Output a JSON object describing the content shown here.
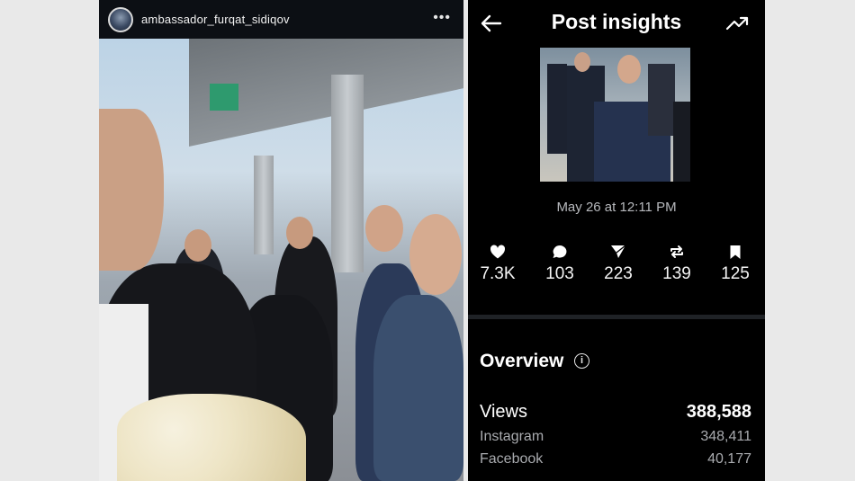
{
  "story": {
    "username": "ambassador_furqat_sidiqov",
    "more_icon": "more-horizontal-icon"
  },
  "insights": {
    "title": "Post insights",
    "back_icon": "arrow-left-icon",
    "trend_icon": "trending-up-icon",
    "date": "May 26 at 12:11 PM",
    "stats": [
      {
        "icon": "heart-icon",
        "value": "7.3K"
      },
      {
        "icon": "comment-icon",
        "value": "103"
      },
      {
        "icon": "send-icon",
        "value": "223"
      },
      {
        "icon": "repost-icon",
        "value": "139"
      },
      {
        "icon": "bookmark-icon",
        "value": "125"
      }
    ],
    "overview": {
      "title": "Overview",
      "views_label": "Views",
      "views_value": "388,588",
      "sources": [
        {
          "label": "Instagram",
          "value": "348,411"
        },
        {
          "label": "Facebook",
          "value": "40,177"
        }
      ]
    }
  }
}
